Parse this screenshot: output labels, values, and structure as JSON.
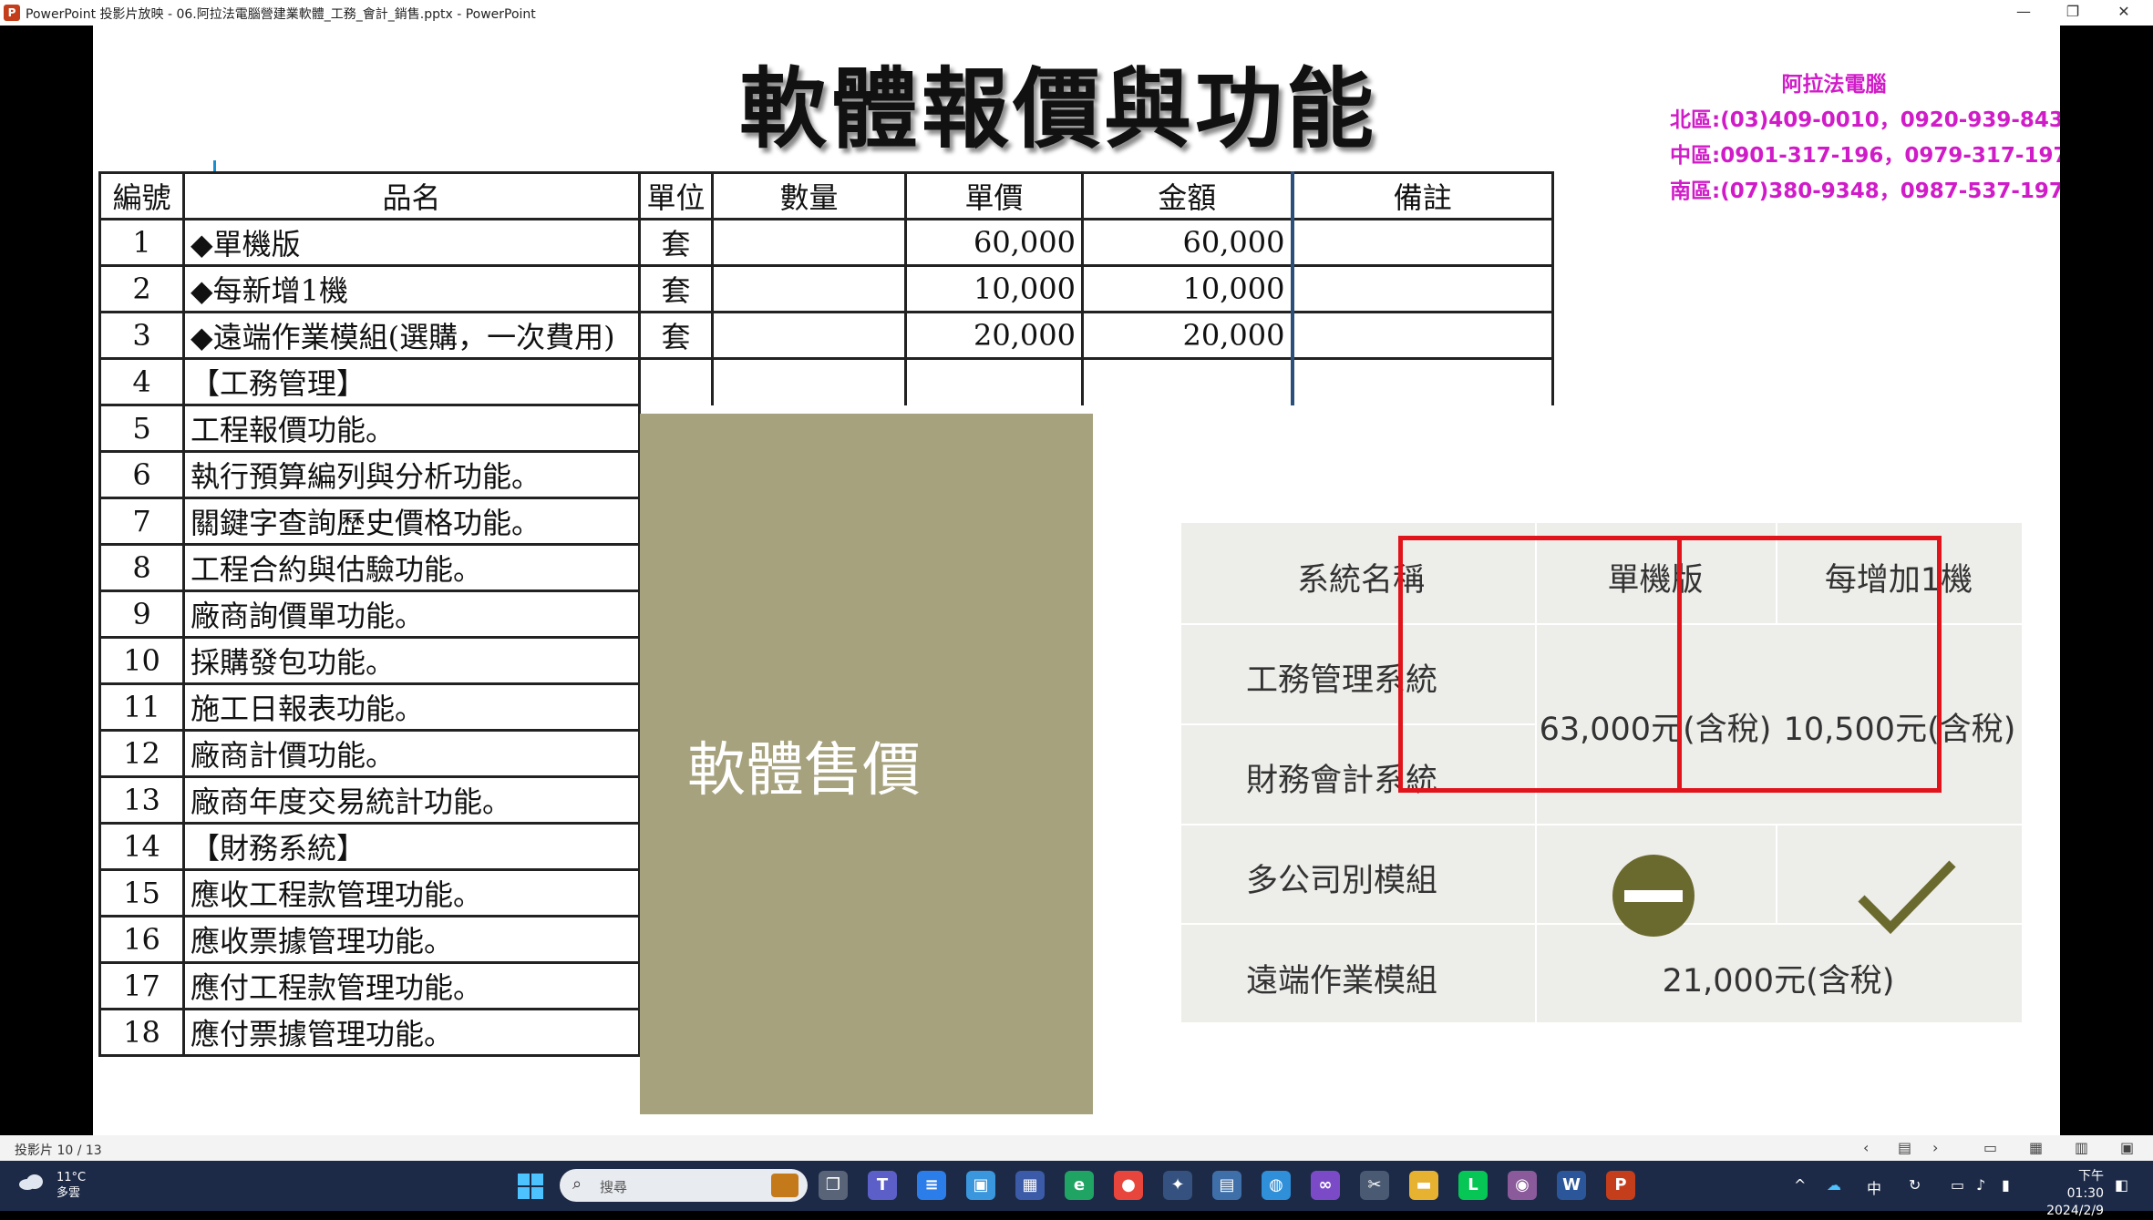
{
  "window": {
    "title": "PowerPoint 投影片放映 - 06.阿拉法電腦營建業軟體_工務_會計_銷售.pptx - PowerPoint",
    "minimize": "—",
    "restore": "❐",
    "close": "✕"
  },
  "slide": {
    "title": "軟體報價與功能",
    "contact": {
      "company": "阿拉法電腦",
      "north": "北區:(03)409-0010，0920-939-843",
      "central": "中區:0901-317-196，0979-317-197",
      "south": "南區:(07)380-9348，0987-537-197"
    },
    "table": {
      "headers": [
        "編號",
        "品名",
        "單位",
        "數量",
        "單價",
        "金額",
        "備註"
      ],
      "priced_rows": [
        {
          "no": "1",
          "name": "◆單機版",
          "unit": "套",
          "qty": "",
          "price": "60,000",
          "amount": "60,000",
          "note": ""
        },
        {
          "no": "2",
          "name": "◆每新增1機",
          "unit": "套",
          "qty": "",
          "price": "10,000",
          "amount": "10,000",
          "note": ""
        },
        {
          "no": "3",
          "name": "◆遠端作業模組(選購，一次費用)",
          "unit": "套",
          "qty": "",
          "price": "20,000",
          "amount": "20,000",
          "note": ""
        },
        {
          "no": "4",
          "name": "【工務管理】",
          "unit": "",
          "qty": "",
          "price": "",
          "amount": "",
          "note": ""
        }
      ],
      "feature_rows": [
        {
          "no": "5",
          "name": "工程報價功能。"
        },
        {
          "no": "6",
          "name": "執行預算編列與分析功能。"
        },
        {
          "no": "7",
          "name": "關鍵字查詢歷史價格功能。"
        },
        {
          "no": "8",
          "name": "工程合約與估驗功能。"
        },
        {
          "no": "9",
          "name": "廠商詢價單功能。"
        },
        {
          "no": "10",
          "name": "採購發包功能。"
        },
        {
          "no": "11",
          "name": "施工日報表功能。"
        },
        {
          "no": "12",
          "name": "廠商計價功能。"
        },
        {
          "no": "13",
          "name": "廠商年度交易統計功能。"
        },
        {
          "no": "14",
          "name": "【財務系統】"
        },
        {
          "no": "15",
          "name": "應收工程款管理功能。"
        },
        {
          "no": "16",
          "name": "應收票據管理功能。"
        },
        {
          "no": "17",
          "name": "應付工程款管理功能。"
        },
        {
          "no": "18",
          "name": "應付票據管理功能。"
        }
      ]
    },
    "sale_box_label": "軟體售價",
    "comparison": {
      "col_header_name": "系統名稱",
      "col_header_single": "單機版",
      "col_header_add": "每增加1機",
      "row_construction": "工務管理系統",
      "row_finance": "財務會計系統",
      "price_single": "63,000元(含稅)",
      "price_add": "10,500元(含稅)",
      "row_multi_company": "多公司別模組",
      "row_remote": "遠端作業模組",
      "price_remote": "21,000元(含稅)"
    }
  },
  "statusbar": {
    "slide_counter": "投影片 10 / 13"
  },
  "taskbar": {
    "weather_temp": "11°C",
    "weather_desc": "多雲",
    "search_placeholder": "搜尋",
    "ime_mode": "中",
    "clock_time": "下午 01:30",
    "clock_date": "2024/2/9"
  },
  "colors": {
    "contact_text": "#d01cc8",
    "highlight_border": "#e1141c",
    "olive_box": "#a6a27d",
    "olive_icon": "#6b6a2e",
    "taskbar_bg": "#1c2a47"
  }
}
